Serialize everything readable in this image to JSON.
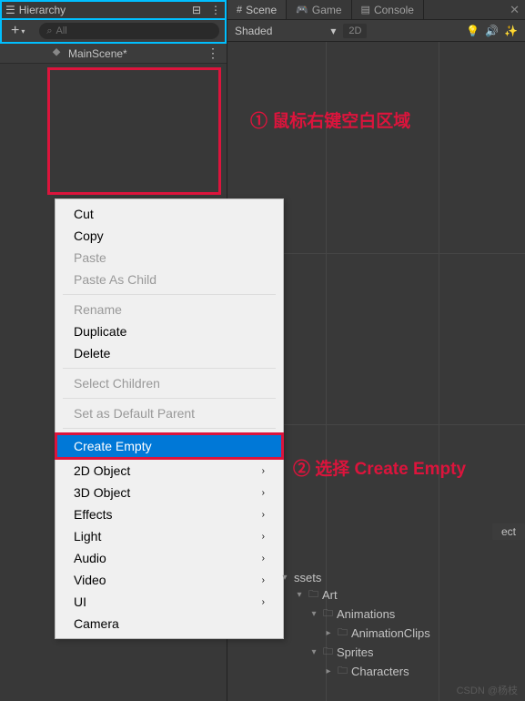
{
  "hierarchy": {
    "title": "Hierarchy",
    "search_placeholder": "All",
    "scene_name": "MainScene*"
  },
  "tabs": {
    "scene": "Scene",
    "game": "Game",
    "console": "Console"
  },
  "scene_toolbar": {
    "shaded": "Shaded",
    "btn_2d": "2D"
  },
  "context_menu": {
    "cut": "Cut",
    "copy": "Copy",
    "paste": "Paste",
    "paste_as_child": "Paste As Child",
    "rename": "Rename",
    "duplicate": "Duplicate",
    "delete": "Delete",
    "select_children": "Select Children",
    "set_default_parent": "Set as Default Parent",
    "create_empty": "Create Empty",
    "obj_2d": "2D Object",
    "obj_3d": "3D Object",
    "effects": "Effects",
    "light": "Light",
    "audio": "Audio",
    "video": "Video",
    "ui": "UI",
    "camera": "Camera"
  },
  "annotations": {
    "step1": "① 鼠标右键空白区域",
    "step2": "② 选择 Create Empty"
  },
  "inspector": {
    "label": "ect"
  },
  "assets": {
    "root": "ssets",
    "art": "Art",
    "animations": "Animations",
    "animation_clips": "AnimationClips",
    "sprites": "Sprites",
    "characters": "Characters"
  },
  "watermark": "CSDN @杨枝"
}
